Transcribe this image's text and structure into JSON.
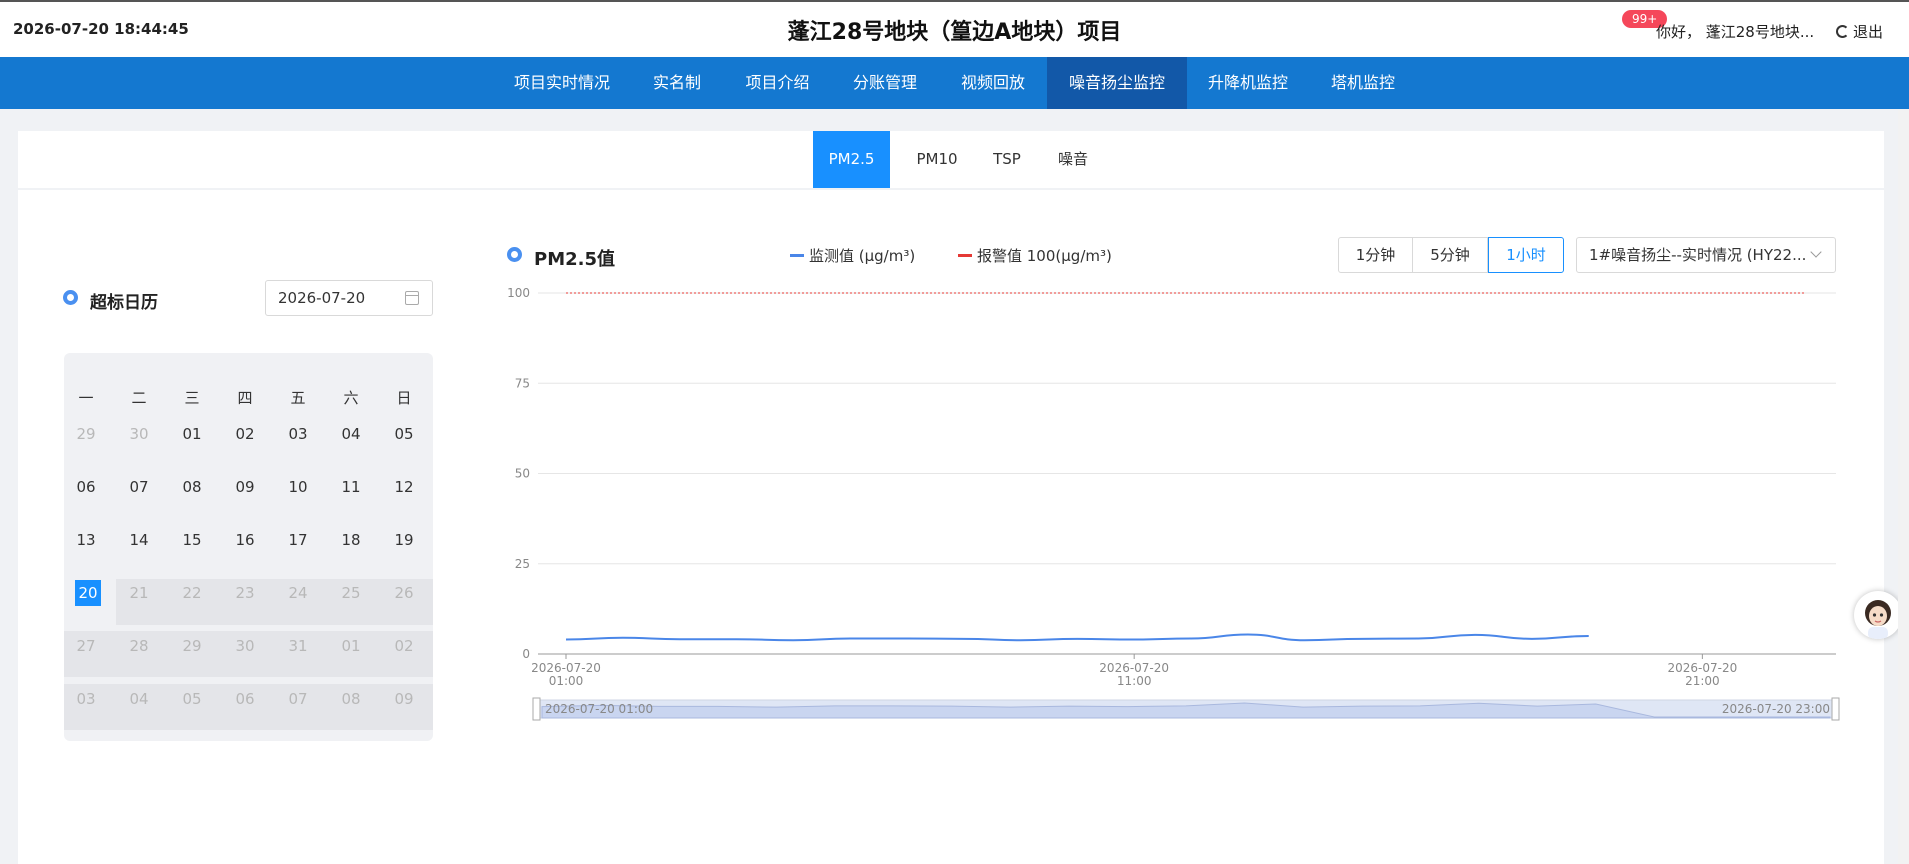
{
  "header": {
    "datetime": "2026-07-20 18:44:45",
    "title": "蓬江28号地块（篁边A地块）项目",
    "badge": "99+",
    "greeting": "你好， 蓬江28号地块...",
    "logout": "退出"
  },
  "nav": {
    "items": [
      "项目实时情况",
      "实名制",
      "项目介绍",
      "分账管理",
      "视频回放",
      "噪音扬尘监控",
      "升降机监控",
      "塔机监控"
    ],
    "active": "噪音扬尘监控"
  },
  "subtabs": {
    "items": [
      "PM2.5",
      "PM10",
      "TSP",
      "噪音"
    ],
    "active": "PM2.5"
  },
  "calendar": {
    "title": "超标日历",
    "date_value": "2026-07-20",
    "weekdays": [
      "一",
      "二",
      "三",
      "四",
      "五",
      "六",
      "日"
    ],
    "days": [
      [
        "29",
        "30",
        "01",
        "02",
        "03",
        "04",
        "05"
      ],
      [
        "06",
        "07",
        "08",
        "09",
        "10",
        "11",
        "12"
      ],
      [
        "13",
        "14",
        "15",
        "16",
        "17",
        "18",
        "19"
      ],
      [
        "20",
        "21",
        "22",
        "23",
        "24",
        "25",
        "26"
      ],
      [
        "27",
        "28",
        "29",
        "30",
        "31",
        "01",
        "02"
      ],
      [
        "03",
        "04",
        "05",
        "06",
        "07",
        "08",
        "09"
      ]
    ],
    "selected_day": "20"
  },
  "panel": {
    "title": "PM2.5值",
    "legend_monitor": "监测值  (μg/m³)",
    "legend_alarm": "报警值  100(μg/m³)",
    "interval_buttons": [
      "1分钟",
      "5分钟",
      "1小时"
    ],
    "interval_active": "1小时",
    "device_select": "1#噪音扬尘--实时情况 (HY22..."
  },
  "colors": {
    "nav_bg": "#1478d0",
    "nav_active": "#1258a8",
    "accent": "#1890ff",
    "series": "#4a86e8",
    "alarm": "#e53935"
  },
  "chart_data": {
    "type": "line",
    "y_ticks": [
      "0",
      "25",
      "50",
      "75",
      "100"
    ],
    "ylim": [
      0,
      100
    ],
    "x_ticks": [
      {
        "date": "2026-07-20",
        "time": "01:00"
      },
      {
        "date": "2026-07-20",
        "time": "11:00"
      },
      {
        "date": "2026-07-20",
        "time": "21:00"
      }
    ],
    "x_hours": [
      "01:00",
      "02:00",
      "03:00",
      "04:00",
      "05:00",
      "06:00",
      "07:00",
      "08:00",
      "09:00",
      "10:00",
      "11:00",
      "12:00",
      "13:00",
      "14:00",
      "15:00",
      "16:00",
      "17:00",
      "18:00",
      "19:00",
      "20:00",
      "21:00",
      "22:00",
      "23:00"
    ],
    "series": [
      {
        "values": [
          4.0,
          4.5,
          4.1,
          4.1,
          3.8,
          4.3,
          4.3,
          4.2,
          3.8,
          4.2,
          4.0,
          4.3,
          5.4,
          3.8,
          4.2,
          4.3,
          5.3,
          4.2,
          5.0
        ]
      }
    ],
    "alarm_value": 100,
    "zoom_start": "2026-07-20 01:00",
    "zoom_end": "2026-07-20 23:00",
    "grid": true
  }
}
